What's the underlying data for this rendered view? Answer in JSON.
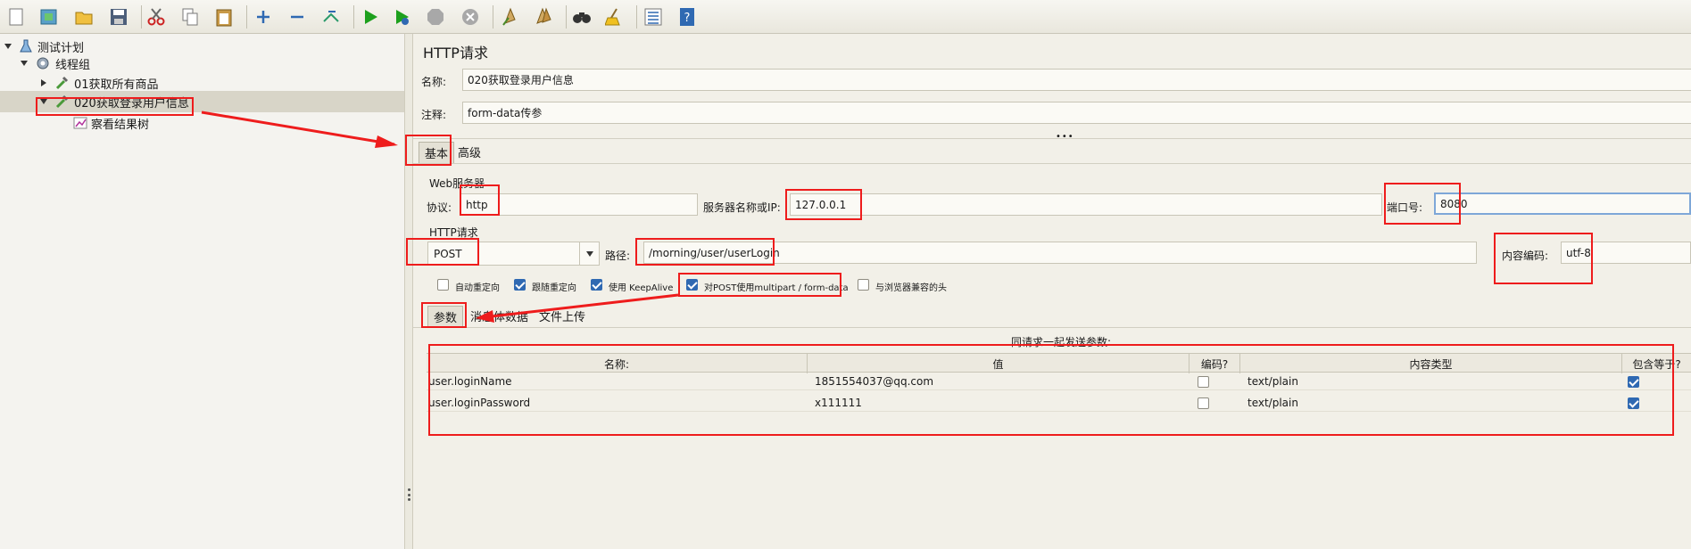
{
  "toolbar": {
    "buttons": [
      "new-icon",
      "templates-icon",
      "open-icon",
      "save-icon",
      "cut-icon",
      "copy-icon",
      "paste-icon",
      "expand-icon",
      "collapse-icon",
      "toggle-icon",
      "start-icon",
      "start-no-pause-icon",
      "stop-icon",
      "shutdown-icon",
      "clear-icon",
      "clear-all-icon",
      "search-icon",
      "reset-search-icon",
      "function-helper-icon",
      "help-icon"
    ]
  },
  "tree": {
    "items": [
      {
        "label": "测试计划",
        "icon": "flask-icon"
      },
      {
        "label": "线程组",
        "icon": "gear-icon"
      },
      {
        "label": "01获取所有商品",
        "icon": "pipette-icon"
      },
      {
        "label": "020获取登录用户信息",
        "icon": "pipette-icon"
      },
      {
        "label": "察看结果树",
        "icon": "chart-icon"
      }
    ]
  },
  "panel": {
    "title": "HTTP请求",
    "name_label": "名称:",
    "name_value": "020获取登录用户信息",
    "comment_label": "注释:",
    "comment_value": "form-data传参",
    "tabs": [
      "基本",
      "高级"
    ],
    "web_server": {
      "group_label": "Web服务器",
      "protocol_label": "协议:",
      "protocol_value": "http",
      "server_label": "服务器名称或IP:",
      "server_value": "127.0.0.1",
      "port_label": "端口号:",
      "port_value": "8080"
    },
    "http_request": {
      "group_label": "HTTP请求",
      "method_value": "POST",
      "path_label": "路径:",
      "path_value": "/morning/user/userLogin",
      "encoding_label": "内容编码:",
      "encoding_value": "utf-8"
    },
    "options": [
      {
        "label": "自动重定向",
        "checked": false
      },
      {
        "label": "跟随重定向",
        "checked": true
      },
      {
        "label": "使用 KeepAlive",
        "checked": true
      },
      {
        "label": "对POST使用multipart / form-data",
        "checked": true
      },
      {
        "label": "与浏览器兼容的头",
        "checked": false
      }
    ],
    "sub_tabs": [
      "参数",
      "消息体数据",
      "文件上传"
    ],
    "params_caption": "同请求一起发送参数:",
    "table": {
      "headers": [
        "名称:",
        "值",
        "编码?",
        "内容类型",
        "包含等于?"
      ],
      "rows": [
        {
          "name": "user.loginName",
          "value": "1851554037@qq.com",
          "encode": false,
          "content_type": "text/plain",
          "include_equals": true
        },
        {
          "name": "user.loginPassword",
          "value": "x111111",
          "encode": false,
          "content_type": "text/plain",
          "include_equals": true
        }
      ]
    }
  },
  "colors": {
    "annotation": "#ee1c1c",
    "accent": "#2f69b2"
  }
}
